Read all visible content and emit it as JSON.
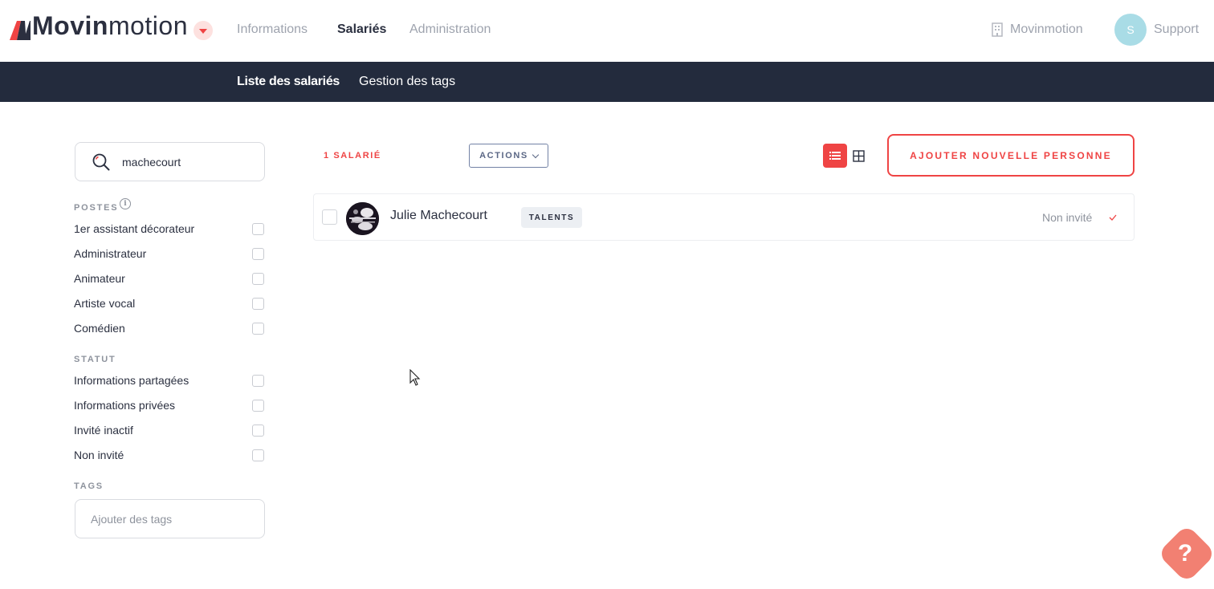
{
  "app": {
    "logo_bold": "Movin",
    "logo_light": "motion"
  },
  "topnav": {
    "items": [
      {
        "label": "Informations",
        "active": false
      },
      {
        "label": "Salariés",
        "active": true
      },
      {
        "label": "Administration",
        "active": false
      }
    ],
    "company": "Movinmotion",
    "avatar_initial": "S",
    "support": "Support"
  },
  "subnav": {
    "items": [
      {
        "label": "Liste des salariés",
        "active": true
      },
      {
        "label": "Gestion des tags",
        "active": false
      }
    ]
  },
  "sidebar": {
    "search": {
      "value": "machecourt"
    },
    "postes_title": "POSTES",
    "postes": [
      "1er assistant décorateur",
      "Administrateur",
      "Animateur",
      "Artiste vocal",
      "Comédien"
    ],
    "statut_title": "STATUT",
    "statut": [
      "Informations partagées",
      "Informations privées",
      "Invité inactif",
      "Non invité"
    ],
    "tags_title": "TAGS",
    "tags_placeholder": "Ajouter des tags"
  },
  "main": {
    "count": "1 SALARIÉ",
    "actions_label": "ACTIONS",
    "add_button": "AJOUTER NOUVELLE PERSONNE",
    "view_mode": "list",
    "rows": [
      {
        "name": "Julie Machecourt",
        "tag": "TALENTS",
        "status": "Non invité"
      }
    ]
  },
  "help": {
    "label": "?"
  },
  "colors": {
    "accent": "#ef4444",
    "navy": "#232b3d",
    "muted": "#9ea3ae",
    "avatar_bg": "#a9dce6"
  }
}
